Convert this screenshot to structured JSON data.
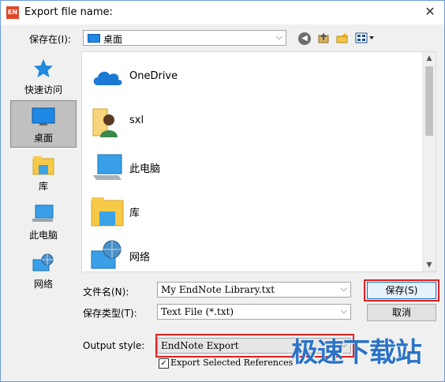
{
  "window": {
    "title": "Export file name:",
    "app_icon_text": "EN",
    "close_glyph": "✕"
  },
  "toolbar": {
    "save_in_label": "保存在(I):",
    "location_value": "桌面",
    "combo_arrow": "⌵",
    "back_icon": "arrow-left-icon",
    "up_icon": "up-folder-icon",
    "new_folder_icon": "new-folder-icon",
    "views_icon": "view-menu-icon"
  },
  "places": [
    {
      "label": "快速访问",
      "icon": "star-icon"
    },
    {
      "label": "桌面",
      "icon": "desktop-icon",
      "active": true
    },
    {
      "label": "库",
      "icon": "library-icon"
    },
    {
      "label": "此电脑",
      "icon": "computer-icon"
    },
    {
      "label": "网络",
      "icon": "network-icon"
    }
  ],
  "files": [
    {
      "label": "OneDrive",
      "icon": "cloud-icon"
    },
    {
      "label": "sxl",
      "icon": "user-folder-icon"
    },
    {
      "label": "此电脑",
      "icon": "computer-icon"
    },
    {
      "label": "库",
      "icon": "library-icon"
    },
    {
      "label": "网络",
      "icon": "network-icon"
    }
  ],
  "form": {
    "filename_label": "文件名(N):",
    "filename_value": "My EndNote Library.txt",
    "filetype_label": "保存类型(T):",
    "filetype_value": "Text File (*.txt)",
    "output_style_label": "Output style:",
    "output_style_value": "EndNote Export",
    "checkbox_label": "Export Selected References",
    "checkbox_checked": true
  },
  "buttons": {
    "save": "保存(S)",
    "cancel": "取消"
  },
  "watermark": "极速下载站",
  "colors": {
    "highlight_red": "#e02020",
    "primary_blue": "#0078d7",
    "watermark_blue": "#2b73c7"
  }
}
